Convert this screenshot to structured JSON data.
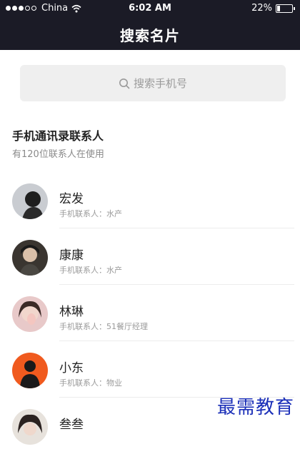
{
  "status_bar": {
    "carrier": "China",
    "time": "6:02 AM",
    "battery": "22%",
    "battery_level": 0.22
  },
  "nav": {
    "title": "搜索名片"
  },
  "search": {
    "placeholder": "搜索手机号"
  },
  "section": {
    "title": "手机通讯录联系人",
    "subtitle": "有120位联系人在使用"
  },
  "contacts": [
    {
      "name": "宏发",
      "detail": "手机联系人：水产"
    },
    {
      "name": "康康",
      "detail": "手机联系人：水产"
    },
    {
      "name": "林琳",
      "detail": "手机联系人：51餐厅经理"
    },
    {
      "name": "小东",
      "detail": "手机联系人：物业"
    },
    {
      "name": "叁叁",
      "detail": ""
    }
  ],
  "watermark": "最需教育",
  "colors": {
    "header_bg": "#1b1b26",
    "watermark": "#1b2fb8"
  }
}
